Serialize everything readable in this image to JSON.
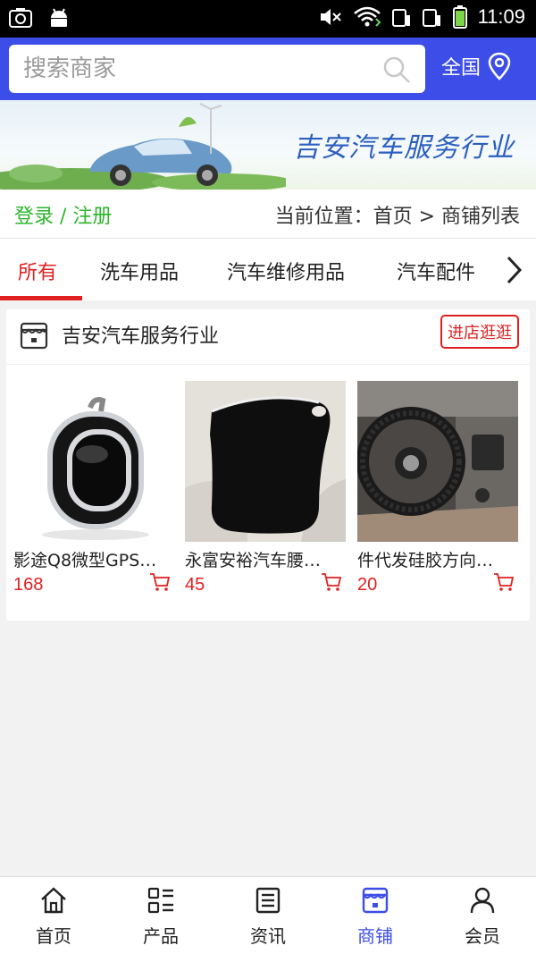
{
  "status_bar": {
    "time": "11:09"
  },
  "search": {
    "placeholder": "搜索商家",
    "region_label": "全国"
  },
  "banner": {
    "title": "吉安汽车服务行业"
  },
  "breadcrumb": {
    "login_text": "登录 / 注册",
    "location_text": "当前位置：首页 > 商铺列表"
  },
  "tabs": [
    {
      "label": "所有",
      "active": true
    },
    {
      "label": "洗车用品"
    },
    {
      "label": "汽车维修用品"
    },
    {
      "label": "汽车配件"
    }
  ],
  "shop": {
    "name": "吉安汽车服务行业",
    "visit_label": "进店逛逛",
    "products": [
      {
        "name": "影途Q8微型GPS…",
        "price": "168"
      },
      {
        "name": "永富安裕汽车腰…",
        "price": "45"
      },
      {
        "name": "件代发硅胶方向…",
        "price": "20"
      }
    ]
  },
  "bottom_nav": [
    {
      "label": "首页",
      "icon": "home-icon"
    },
    {
      "label": "产品",
      "icon": "grid-list-icon"
    },
    {
      "label": "资讯",
      "icon": "news-icon"
    },
    {
      "label": "商铺",
      "icon": "store-icon",
      "active": true
    },
    {
      "label": "会员",
      "icon": "user-icon"
    }
  ],
  "colors": {
    "accent": "#3d4ee8",
    "highlight": "#e02020",
    "login": "#2db52d"
  }
}
